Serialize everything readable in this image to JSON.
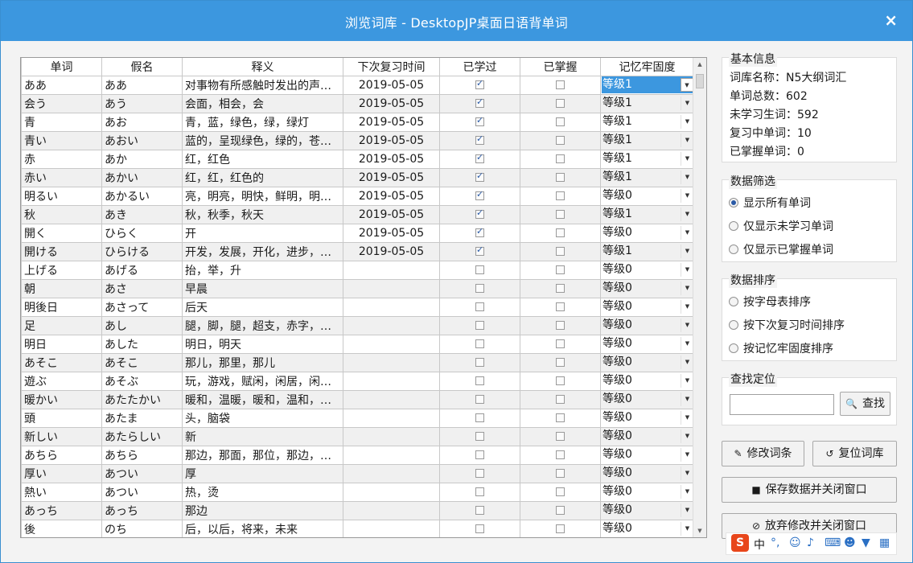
{
  "window": {
    "title": "浏览词库 - DesktopJP桌面日语背单词",
    "close_glyph": "×"
  },
  "table": {
    "headers": [
      "单词",
      "假名",
      "释义",
      "下次复习时间",
      "已学过",
      "已掌握",
      "记忆牢固度"
    ],
    "rows": [
      {
        "word": "ああ",
        "kana": "ああ",
        "meaning": "对事物有所感触时发出的声…",
        "review": "2019-05-05",
        "learned": true,
        "mastered": false,
        "level": "等级1"
      },
      {
        "word": "会う",
        "kana": "あう",
        "meaning": "会面，相会，会",
        "review": "2019-05-05",
        "learned": true,
        "mastered": false,
        "level": "等级1"
      },
      {
        "word": "青",
        "kana": "あお",
        "meaning": "青，蓝，绿色，绿，绿灯",
        "review": "2019-05-05",
        "learned": true,
        "mastered": false,
        "level": "等级1"
      },
      {
        "word": "青い",
        "kana": "あおい",
        "meaning": "蓝的，呈现绿色，绿的，苍…",
        "review": "2019-05-05",
        "learned": true,
        "mastered": false,
        "level": "等级1"
      },
      {
        "word": "赤",
        "kana": "あか",
        "meaning": "红，红色",
        "review": "2019-05-05",
        "learned": true,
        "mastered": false,
        "level": "等级1"
      },
      {
        "word": "赤い",
        "kana": "あかい",
        "meaning": "红，红，红色的",
        "review": "2019-05-05",
        "learned": true,
        "mastered": false,
        "level": "等级1"
      },
      {
        "word": "明るい",
        "kana": "あかるい",
        "meaning": "亮，明亮，明快，鲜明，明…",
        "review": "2019-05-05",
        "learned": true,
        "mastered": false,
        "level": "等级0"
      },
      {
        "word": "秋",
        "kana": "あき",
        "meaning": "秋，秋季，秋天",
        "review": "2019-05-05",
        "learned": true,
        "mastered": false,
        "level": "等级1"
      },
      {
        "word": "開く",
        "kana": "ひらく",
        "meaning": "开",
        "review": "2019-05-05",
        "learned": true,
        "mastered": false,
        "level": "等级0"
      },
      {
        "word": "開ける",
        "kana": "ひらける",
        "meaning": "开发，发展，开化，进步，…",
        "review": "2019-05-05",
        "learned": true,
        "mastered": false,
        "level": "等级1"
      },
      {
        "word": "上げる",
        "kana": "あげる",
        "meaning": "抬，举，升",
        "review": "",
        "learned": false,
        "mastered": false,
        "level": "等级0"
      },
      {
        "word": "朝",
        "kana": "あさ",
        "meaning": "早晨",
        "review": "",
        "learned": false,
        "mastered": false,
        "level": "等级0"
      },
      {
        "word": "明後日",
        "kana": "あさって",
        "meaning": "后天",
        "review": "",
        "learned": false,
        "mastered": false,
        "level": "等级0"
      },
      {
        "word": "足",
        "kana": "あし",
        "meaning": "腿，脚，腿，超支，赤字，…",
        "review": "",
        "learned": false,
        "mastered": false,
        "level": "等级0"
      },
      {
        "word": "明日",
        "kana": "あした",
        "meaning": "明日，明天",
        "review": "",
        "learned": false,
        "mastered": false,
        "level": "等级0"
      },
      {
        "word": "あそこ",
        "kana": "あそこ",
        "meaning": "那儿，那里，那儿",
        "review": "",
        "learned": false,
        "mastered": false,
        "level": "等级0"
      },
      {
        "word": "遊ぶ",
        "kana": "あそぶ",
        "meaning": "玩，游戏，赋闲，闲居，闲…",
        "review": "",
        "learned": false,
        "mastered": false,
        "level": "等级0"
      },
      {
        "word": "暖かい",
        "kana": "あたたかい",
        "meaning": "暖和，温暖，暖和，温和，…",
        "review": "",
        "learned": false,
        "mastered": false,
        "level": "等级0"
      },
      {
        "word": "頭",
        "kana": "あたま",
        "meaning": "头，脑袋",
        "review": "",
        "learned": false,
        "mastered": false,
        "level": "等级0"
      },
      {
        "word": "新しい",
        "kana": "あたらしい",
        "meaning": "新",
        "review": "",
        "learned": false,
        "mastered": false,
        "level": "等级0"
      },
      {
        "word": "あちら",
        "kana": "あちら",
        "meaning": "那边，那面，那位，那边，…",
        "review": "",
        "learned": false,
        "mastered": false,
        "level": "等级0"
      },
      {
        "word": "厚い",
        "kana": "あつい",
        "meaning": "厚",
        "review": "",
        "learned": false,
        "mastered": false,
        "level": "等级0"
      },
      {
        "word": "熱い",
        "kana": "あつい",
        "meaning": "热，烫",
        "review": "",
        "learned": false,
        "mastered": false,
        "level": "等级0"
      },
      {
        "word": "あっち",
        "kana": "あっち",
        "meaning": "那边",
        "review": "",
        "learned": false,
        "mastered": false,
        "level": "等级0"
      },
      {
        "word": "後",
        "kana": "のち",
        "meaning": "后，以后，将来，未来",
        "review": "",
        "learned": false,
        "mastered": false,
        "level": "等级0"
      }
    ]
  },
  "info": {
    "title": "基本信息",
    "lines": [
      "词库名称：N5大纲词汇",
      "单词总数：602",
      "未学习生词：592",
      "复习中单词：10",
      "已掌握单词：0"
    ]
  },
  "filter": {
    "title": "数据筛选",
    "options": [
      "显示所有单词",
      "仅显示未学习单词",
      "仅显示已掌握单词"
    ]
  },
  "sort": {
    "title": "数据排序",
    "options": [
      "按字母表排序",
      "按下次复习时间排序",
      "按记忆牢固度排序"
    ]
  },
  "search": {
    "title": "查找定位",
    "value": "",
    "button": "查找"
  },
  "buttons": {
    "edit": "修改词条",
    "reset": "复位词库",
    "save_close": "保存数据并关闭窗口",
    "discard_close": "放弃修改并关闭窗口"
  },
  "ime": {
    "logo": "S",
    "lang": "中"
  }
}
